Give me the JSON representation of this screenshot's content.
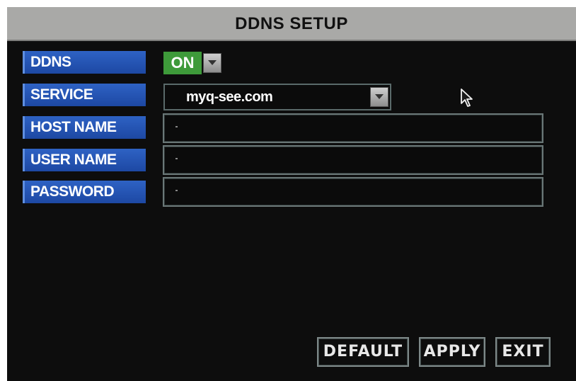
{
  "title": "DDNS SETUP",
  "fields": {
    "ddns": {
      "label": "DDNS",
      "value": "ON"
    },
    "service": {
      "label": "SERVICE",
      "value": "myq-see.com"
    },
    "host_name": {
      "label": "HOST NAME",
      "value": ""
    },
    "user_name": {
      "label": "USER NAME",
      "value": ""
    },
    "password": {
      "label": "PASSWORD",
      "value": ""
    }
  },
  "buttons": {
    "default": "DEFAULT",
    "apply": "APPLY",
    "exit": "EXIT"
  },
  "colors": {
    "title_bar": "#a9a9a7",
    "label_bg": "#2e62c4",
    "toggle_on": "#3e9a3a",
    "background": "#0d0d0d"
  },
  "icons": {
    "dropdown": "chevron-down-icon",
    "cursor": "mouse-pointer-icon"
  }
}
